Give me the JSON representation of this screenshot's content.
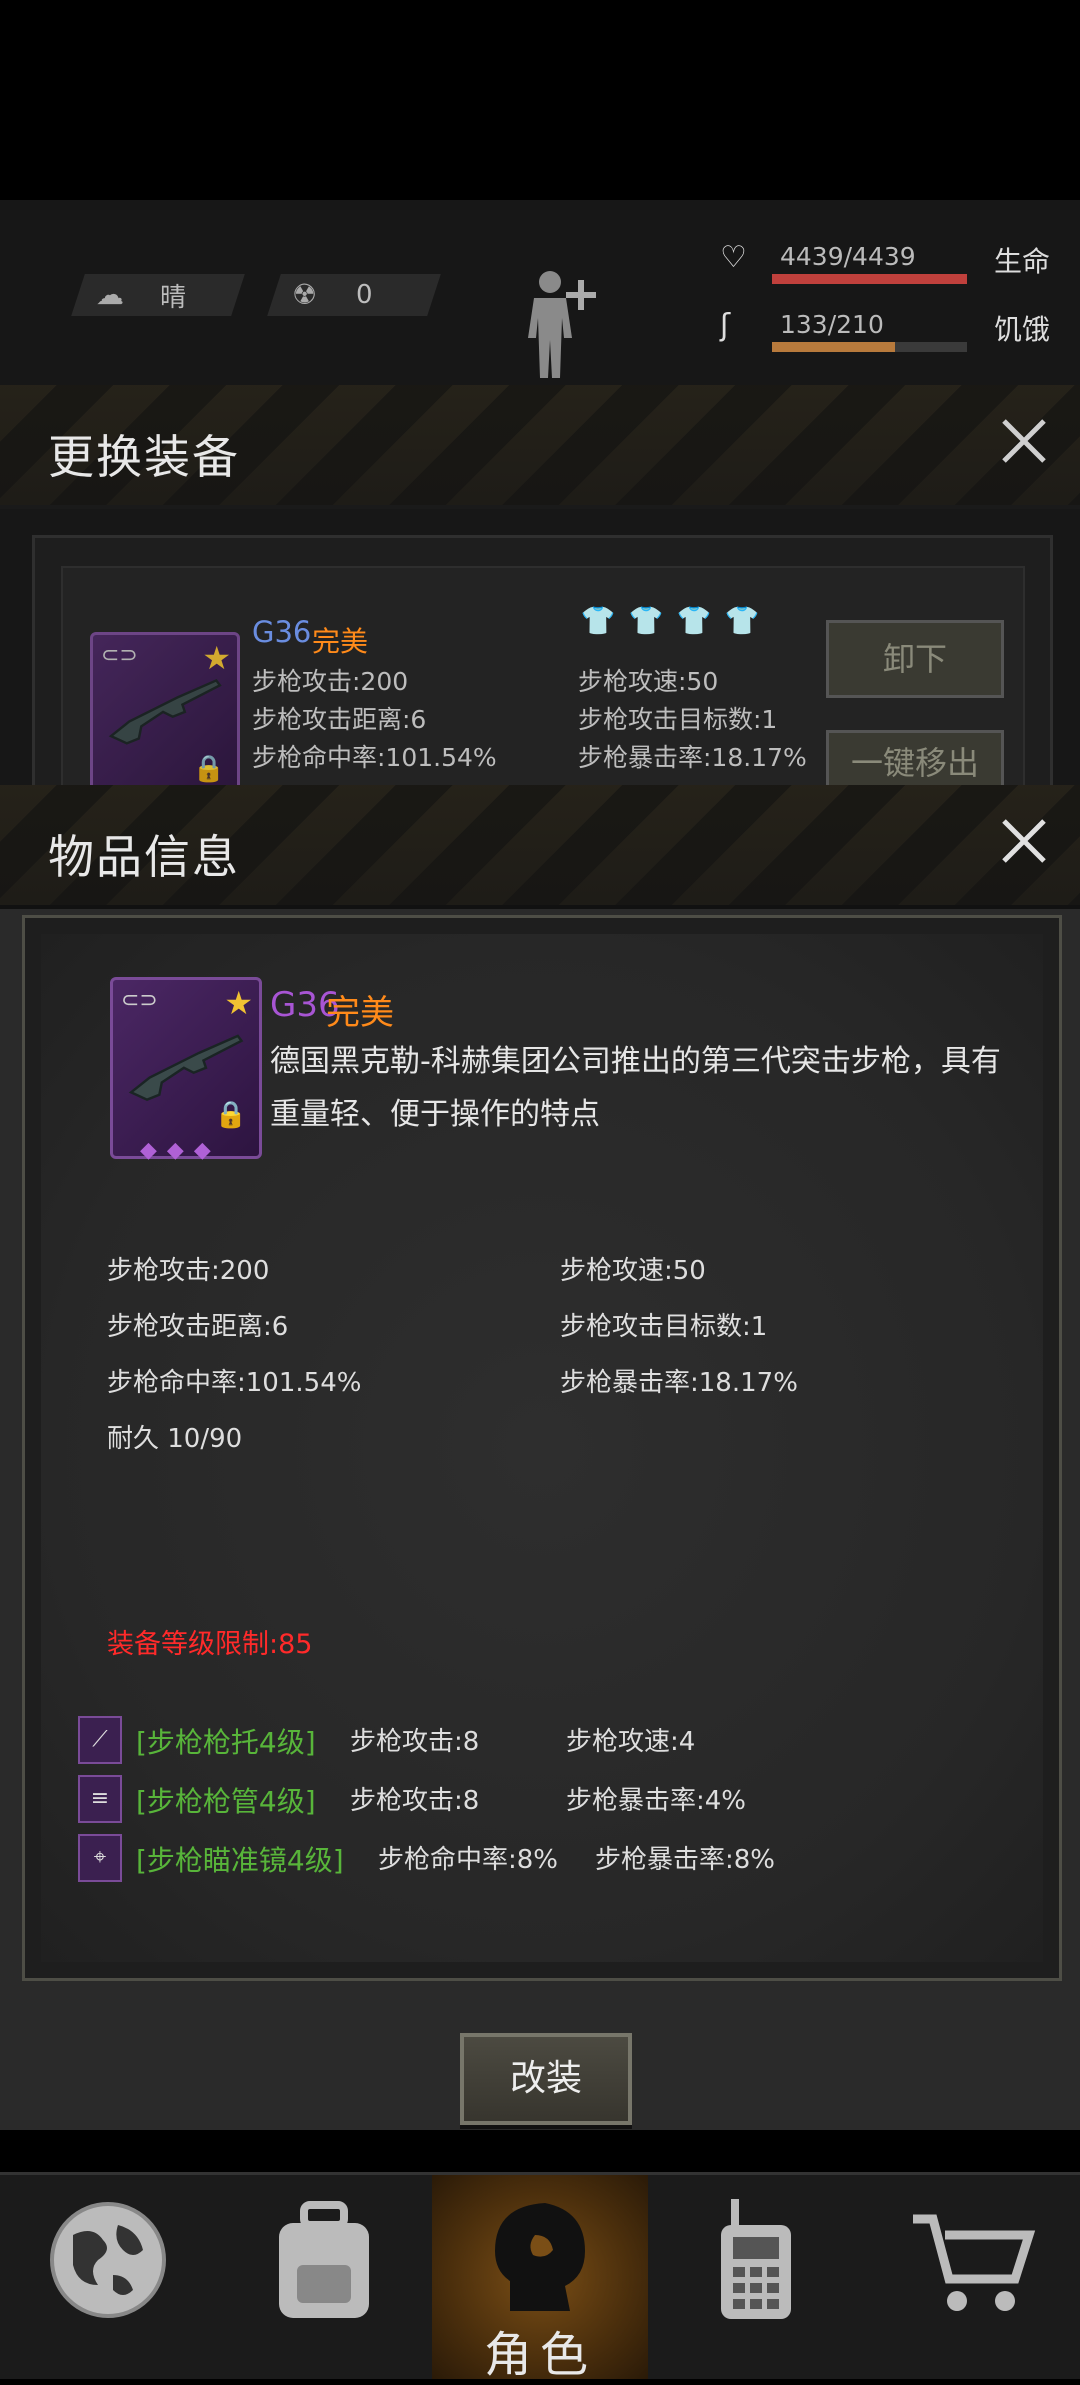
{
  "status": {
    "weather_label": "晴",
    "radiation_value": "0",
    "health": {
      "text": "4439/4439",
      "label": "生命",
      "fraction": 1.0,
      "color": "#c0403c"
    },
    "hunger": {
      "text": "133/210",
      "label": "饥饿",
      "fraction": 0.63,
      "color": "#b87a3c"
    }
  },
  "equip_panel": {
    "title": "更换装备",
    "item": {
      "name": "G36",
      "quality": "完美",
      "stats_left": [
        "步枪攻击:200",
        "步枪攻击距离:6",
        "步枪命中率:101.54%"
      ],
      "stats_right": [
        "步枪攻速:50",
        "步枪攻击目标数:1",
        "步枪暴击率:18.17%"
      ]
    },
    "unequip_label": "卸下",
    "remove_all_label": "一键移出"
  },
  "item_info": {
    "title": "物品信息",
    "name": "G36",
    "quality": "完美",
    "description": "德国黑克勒-科赫集团公司推出的第三代突击步枪，具有重量轻、便于操作的特点",
    "stats_left": [
      "步枪攻击:200",
      "步枪攻击距离:6",
      "步枪命中率:101.54%",
      "耐久 10/90"
    ],
    "stats_right": [
      "步枪攻速:50",
      "步枪攻击目标数:1",
      "步枪暴击率:18.17%"
    ],
    "level_limit": "装备等级限制:85",
    "mods": [
      {
        "name": "[步枪枪托4级]",
        "stat1": "步枪攻击:8",
        "stat2": "步枪攻速:4"
      },
      {
        "name": "[步枪枪管4级]",
        "stat1": "步枪攻击:8",
        "stat2": "步枪暴击率:4%"
      },
      {
        "name": "[步枪瞄准镜4级]",
        "stat1": "步枪命中率:8%",
        "stat2": "步枪暴击率:8%"
      }
    ],
    "modify_label": "改装"
  },
  "bottom_nav": {
    "active_label": "角色",
    "items": [
      "globe-icon",
      "backpack-icon",
      "character-icon",
      "radio-icon",
      "cart-icon"
    ]
  },
  "colors": {
    "item_name": "#6a8de0",
    "item_name_dialog": "#a855d4",
    "quality": "#ff8a1a",
    "level_limit": "#ff2a2a",
    "mod_name": "#58b53a"
  }
}
